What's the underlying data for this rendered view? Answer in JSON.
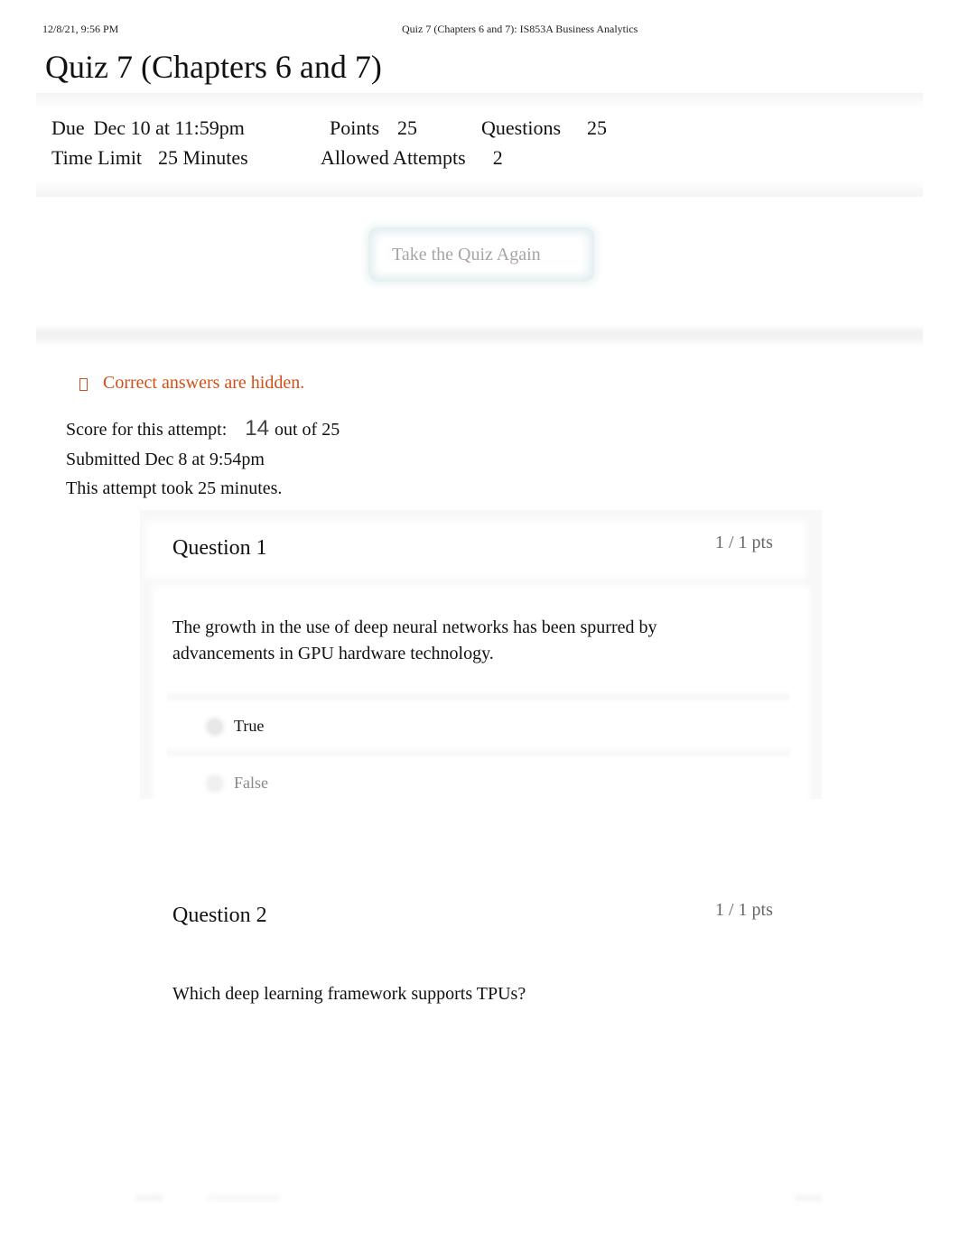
{
  "print_header": {
    "date": "12/8/21, 9:56 PM",
    "title": "Quiz 7 (Chapters 6 and 7): IS853A Business Analytics"
  },
  "quiz": {
    "title": "Quiz 7 (Chapters 6 and 7)",
    "details": {
      "due_label": "Due",
      "due_value": "Dec 10 at 11:59pm",
      "points_label": "Points",
      "points_value": "25",
      "questions_label": "Questions",
      "questions_value": "25",
      "time_limit_label": "Time Limit",
      "time_limit_value": "25 Minutes",
      "allowed_attempts_label": "Allowed Attempts",
      "allowed_attempts_value": "2"
    },
    "take_again_button": "Take the Quiz Again"
  },
  "attempt": {
    "notice_icon": "info-box-icon",
    "notice": "Correct answers are hidden.",
    "score_label": "Score for this attempt:",
    "score_value": "14",
    "score_suffix": "out of 25",
    "submitted": "Submitted Dec 8 at 9:54pm",
    "duration": "This attempt took 25 minutes."
  },
  "questions": [
    {
      "title": "Question 1",
      "points": "1 / 1 pts",
      "text": "The growth in the use of deep neural networks has been spurred by advancements in GPU hardware technology.",
      "answers": [
        {
          "label": "True",
          "selected": true
        },
        {
          "label": "False",
          "selected": false
        }
      ]
    },
    {
      "title": "Question 2",
      "points": "1 / 1 pts",
      "text": "Which deep learning framework supports TPUs?"
    }
  ]
}
